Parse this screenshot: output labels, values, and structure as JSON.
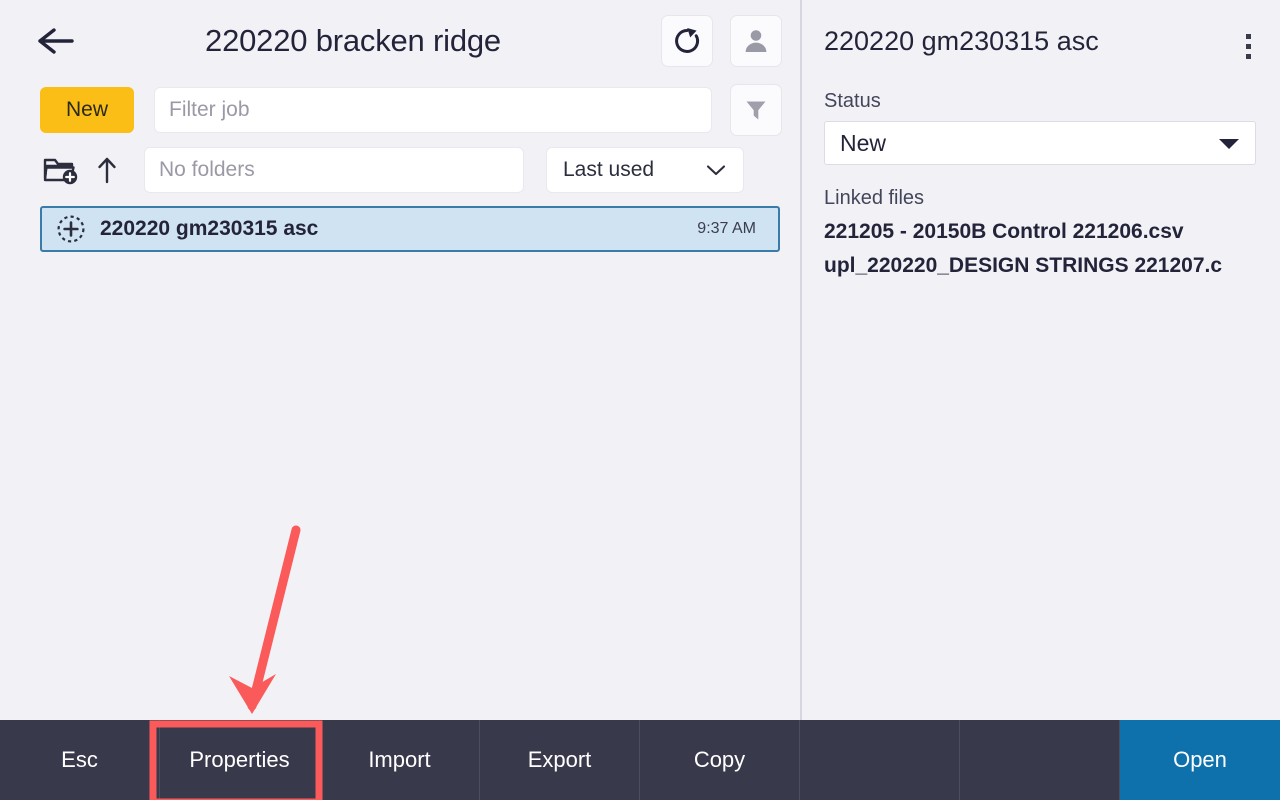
{
  "header": {
    "title": "220220 bracken ridge",
    "back_icon": "arrow-left-icon",
    "refresh_icon": "refresh-icon",
    "account_icon": "user-icon"
  },
  "toolbar": {
    "new_label": "New",
    "filter_placeholder": "Filter job",
    "filter_value": "",
    "filter_icon": "funnel-icon",
    "add_folder_icon": "folder-add-icon",
    "up_icon": "arrow-up-icon",
    "folders_placeholder": "No folders",
    "folders_value": "",
    "sort_value": "Last used",
    "sort_chevron_icon": "chevron-down-icon"
  },
  "job_list": {
    "rows": [
      {
        "icon": "dashed-circle-plus-icon",
        "name": "220220 gm230315 asc",
        "time": "9:37 AM",
        "selected": true
      }
    ]
  },
  "detail": {
    "title": "220220 gm230315 asc",
    "menu_icon": "kebab-menu-icon",
    "status_label": "Status",
    "status_value": "New",
    "status_chevron_icon": "chevron-down-filled-icon",
    "linked_files_label": "Linked files",
    "linked_files": [
      "221205 - 20150B Control 221206.csv",
      "upl_220220_DESIGN STRINGS 221207.c"
    ]
  },
  "bottom_bar": {
    "cells": [
      {
        "label": "Esc",
        "style": "normal"
      },
      {
        "label": "Properties",
        "style": "highlighted"
      },
      {
        "label": "Import",
        "style": "normal"
      },
      {
        "label": "Export",
        "style": "normal"
      },
      {
        "label": "Copy",
        "style": "normal"
      },
      {
        "label": "",
        "style": "empty"
      },
      {
        "label": "",
        "style": "empty"
      },
      {
        "label": "Open",
        "style": "primary"
      }
    ]
  },
  "annotation": {
    "arrow_color": "#fb5a5a",
    "highlight_color": "#fb5a5a",
    "target": "Properties"
  },
  "colors": {
    "page_background": "#f2f2f6",
    "accent_new": "#fbbe17",
    "bar_background": "#383a4c",
    "open_button": "#0e71ac",
    "selection_fill": "#cfe3f2",
    "selection_border": "#3a7ca8"
  }
}
